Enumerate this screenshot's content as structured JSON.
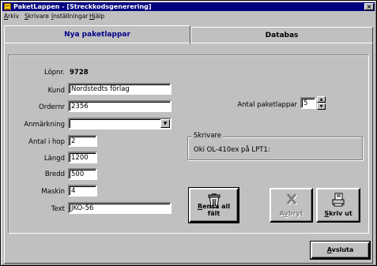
{
  "window": {
    "title": "PaketLappen - [Streckkodsgenerering]",
    "close_glyph": "×"
  },
  "menu": {
    "items": [
      {
        "u": "A",
        "rest": "rkiv"
      },
      {
        "u": "S",
        "rest": "krivare"
      },
      {
        "u": "I",
        "rest": "nställningar"
      },
      {
        "u": "H",
        "rest": "jälp"
      }
    ]
  },
  "tabs": {
    "new_labels": "Nya paketlappar",
    "database": "Databas"
  },
  "form": {
    "lopnr_label": "Löpnr.",
    "lopnr_value": "9728",
    "kund_label": "Kund",
    "kund_value": "Nordstedts förlag",
    "ordernr_label": "Ordernr",
    "ordernr_value": "2356",
    "anmarkning_label": "Anmärkning",
    "anmarkning_value": "",
    "antal_i_hop_label": "Antal i hop",
    "antal_i_hop_value": "2",
    "langd_label": "Längd",
    "langd_value": "1200",
    "bredd_label": "Bredd",
    "bredd_value": "500",
    "maskin_label": "Maskin",
    "maskin_value": "4",
    "text_label": "Text",
    "text_value": "JKO-56",
    "antal_paketlappar_label": "Antal paketlappar",
    "antal_paketlappar_value": "5"
  },
  "printer": {
    "group_title": "Skrivare",
    "name": "Oki OL-410ex på LPT1:"
  },
  "buttons": {
    "clear": {
      "u": "R",
      "rest": "ensa all fält",
      "icon": "trash-can-icon"
    },
    "cancel": {
      "pre": "A",
      "u": "v",
      "rest": "bryt",
      "icon": "x-icon"
    },
    "print": {
      "u": "S",
      "rest": "kriv ut",
      "icon": "printer-icon"
    },
    "quit": {
      "u": "A",
      "rest": "vsluta"
    }
  },
  "colors": {
    "titlebar": "#000080",
    "face": "#c0c0c0",
    "active_tab_text": "#00008b"
  }
}
